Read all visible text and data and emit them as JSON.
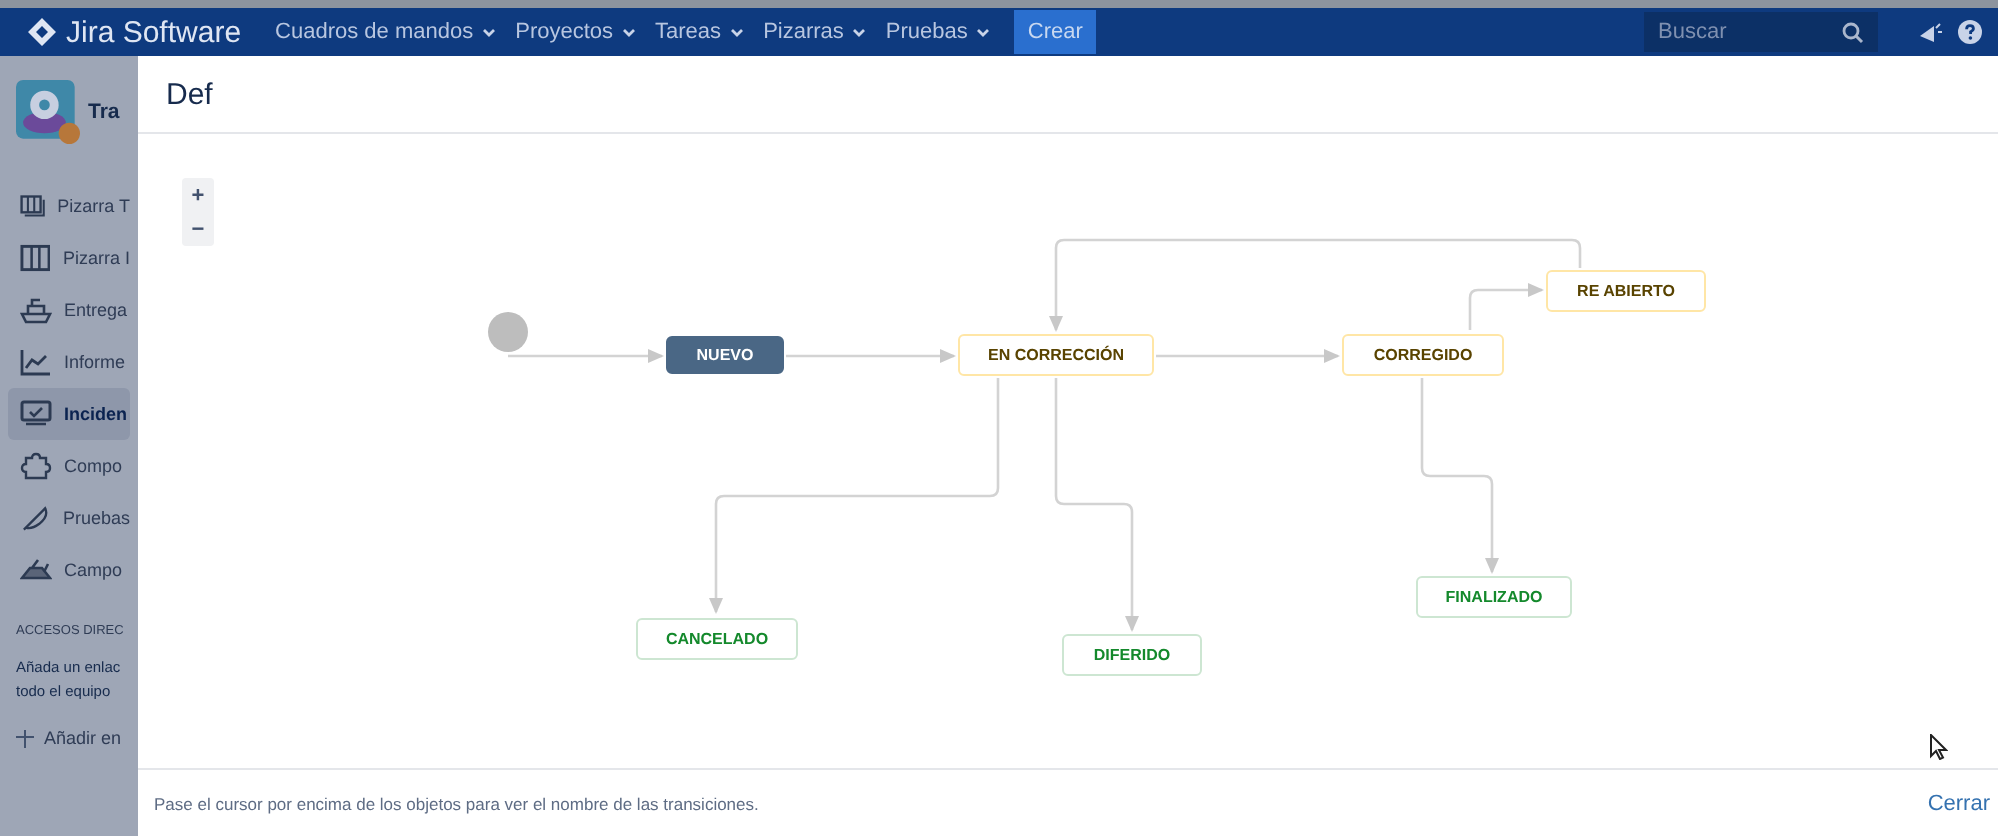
{
  "topbar": {
    "product": "Jira Software",
    "menus": [
      {
        "label": "Cuadros de mandos"
      },
      {
        "label": "Proyectos"
      },
      {
        "label": "Tareas"
      },
      {
        "label": "Pizarras"
      },
      {
        "label": "Pruebas"
      }
    ],
    "create_button": "Crear",
    "search": {
      "placeholder": "Buscar"
    }
  },
  "sidebar": {
    "project": "Tra",
    "items": [
      {
        "label": "Pizarra T",
        "selected": false
      },
      {
        "label": "Pizarra I",
        "selected": false
      },
      {
        "label": "Entrega",
        "selected": false
      },
      {
        "label": "Informe",
        "selected": false
      },
      {
        "label": "Inciden",
        "selected": true
      },
      {
        "label": "Compo",
        "selected": false
      },
      {
        "label": "Pruebas",
        "selected": false
      },
      {
        "label": "Campo",
        "selected": false
      }
    ],
    "shortcuts_heading": "ACCESOS DIREC",
    "shortcuts_text": [
      "Añada un enlac",
      "todo el equipo"
    ],
    "add_shortcut": "Añadir en"
  },
  "dialog": {
    "title": "Def",
    "zoom_in": "+",
    "zoom_out": "−",
    "statuses": [
      {
        "label": "NUEVO",
        "kind": "todo"
      },
      {
        "label": "EN CORRECCIÓN",
        "kind": "in_progress"
      },
      {
        "label": "CORREGIDO",
        "kind": "in_progress"
      },
      {
        "label": "RE ABIERTO",
        "kind": "in_progress"
      },
      {
        "label": "CANCELADO",
        "kind": "done"
      },
      {
        "label": "DIFERIDO",
        "kind": "done"
      },
      {
        "label": "FINALIZADO",
        "kind": "done"
      }
    ],
    "hint": "Pase el cursor por encima de los objetos para ver el nombre de las transiciones.",
    "close": "Cerrar"
  }
}
